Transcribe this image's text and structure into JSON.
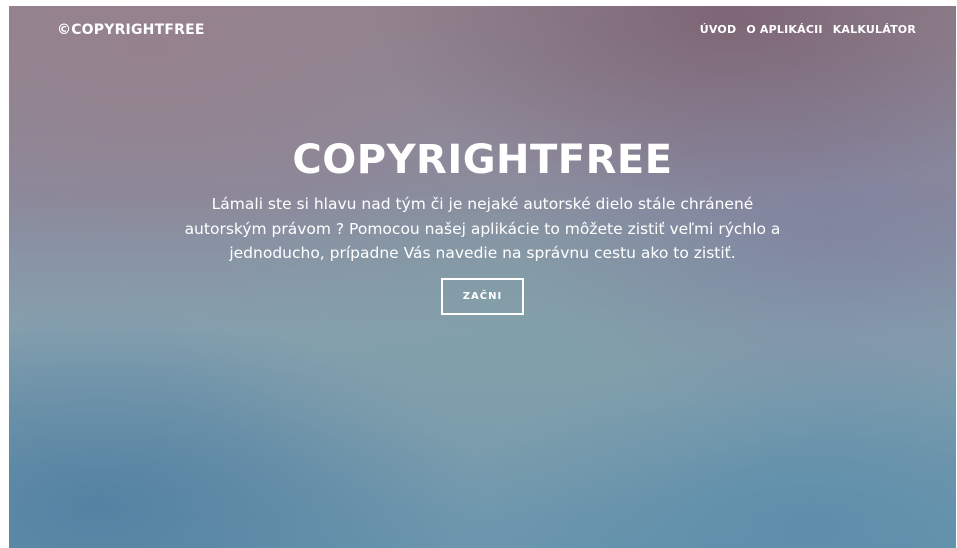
{
  "navbar": {
    "brand": "©COPYRIGHTFREE",
    "links": [
      {
        "label": "ÚVOD"
      },
      {
        "label": "O APLIKÁCII"
      },
      {
        "label": "KALKULÁTOR"
      }
    ]
  },
  "hero": {
    "title": "COPYRIGHTFREE",
    "text": "Lámali ste si hlavu nad tým či je nejaké autorské dielo stále chránené autorským právom ? Pomocou našej aplikácie to môžete zistiť veľmi rýchlo a jednoducho, prípadne Vás navedie na správnu cestu ako to zistiť.",
    "cta_label": "ZAČNI"
  },
  "colors": {
    "text": "#ffffff",
    "background_top": "#938590",
    "background_bottom": "#6d97ae"
  }
}
